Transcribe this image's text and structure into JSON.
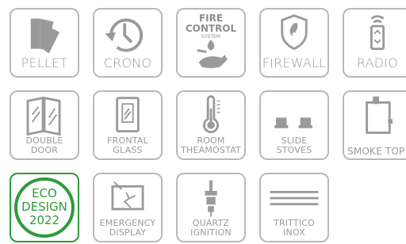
{
  "tiles": {
    "pellet": {
      "label": "PELLET"
    },
    "crono": {
      "label": "CRONO"
    },
    "fire_control": {
      "line1": "FIRE",
      "line2": "CONTROL",
      "line3": "SYSTEM"
    },
    "firewall": {
      "label": "FIREWALL"
    },
    "radio": {
      "label": "RADIO"
    },
    "double_door": {
      "line1": "DOUBLE",
      "line2": "DOOR"
    },
    "frontal_glass": {
      "line1": "FRONTAL",
      "line2": "GLASS"
    },
    "room_thermostat": {
      "line1": "ROOM",
      "line2": "THEAMOSTAT"
    },
    "slide_stoves": {
      "line1": "SLIDE",
      "line2": "STOVES"
    },
    "smoke_top": {
      "label": "SMOKE TOP"
    },
    "eco_design": {
      "line1": "ECO",
      "line2": "DESIGN",
      "line3": "2022"
    },
    "emergency_display": {
      "line1": "EMERGENCY",
      "line2": "DISPLAY"
    },
    "quartz_ignition": {
      "line1": "QUARTZ",
      "line2": "IGNITION"
    },
    "trittico_inox": {
      "line1": "TRITTICO",
      "line2": "INOX"
    }
  },
  "colors": {
    "icon_gray": "#9a9a9a",
    "border_gray": "#b9b9b9",
    "eco_green": "#2e9b3a"
  }
}
